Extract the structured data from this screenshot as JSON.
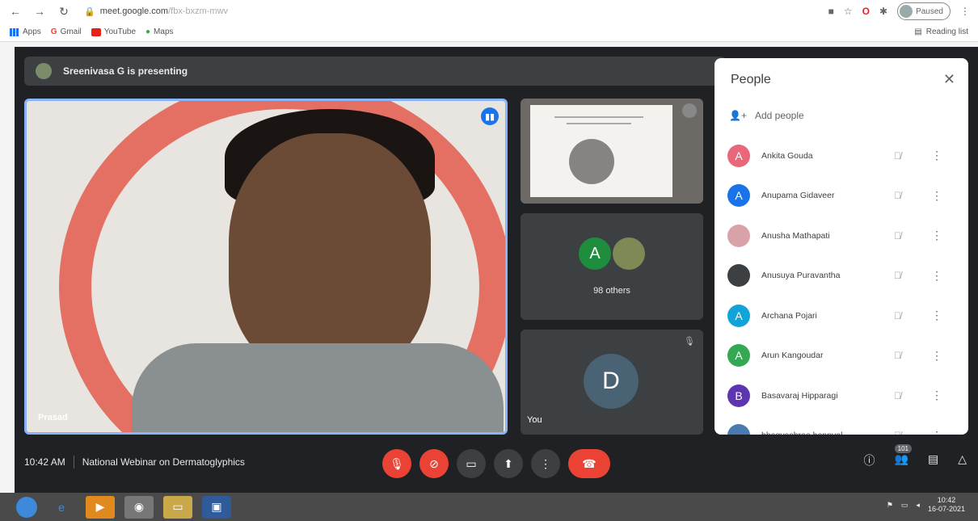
{
  "browser": {
    "url_host": "meet.google.com",
    "url_path": "/fbx-bxzm-mwv",
    "profile_status": "Paused",
    "bookmarks": [
      "Apps",
      "Gmail",
      "YouTube",
      "Maps"
    ],
    "reading_list": "Reading list"
  },
  "meet": {
    "presenting_text": "Sreenivasa G is presenting",
    "main_tile_name": "Prasad",
    "others_avatar_letter": "A",
    "others_label": "98 others",
    "self_avatar_letter": "D",
    "self_label": "You"
  },
  "people_panel": {
    "title": "People",
    "add_people": "Add people",
    "participants": [
      {
        "initial": "A",
        "name": "Ankita Gouda",
        "color": "#e8677a"
      },
      {
        "initial": "A",
        "name": "Anupama Gidaveer",
        "color": "#1a73e8"
      },
      {
        "initial": "",
        "name": "Anusha Mathapati",
        "color": "#d9a2a8"
      },
      {
        "initial": "",
        "name": "Anusuya Puravantha",
        "color": "#3c4043"
      },
      {
        "initial": "A",
        "name": "Archana Pojari",
        "color": "#12a4d9"
      },
      {
        "initial": "A",
        "name": "Arun Kangoudar",
        "color": "#34a853"
      },
      {
        "initial": "B",
        "name": "Basavaraj Hipparagi",
        "color": "#5e35b1"
      },
      {
        "initial": "",
        "name": "bhagyashree honnyal",
        "color": "#4a7ab0"
      }
    ]
  },
  "bottom_bar": {
    "time": "10:42 AM",
    "meeting_title": "National Webinar on Dermatoglyphics",
    "participant_count": "101"
  },
  "taskbar": {
    "time": "10:42",
    "date": "16-07-2021"
  }
}
